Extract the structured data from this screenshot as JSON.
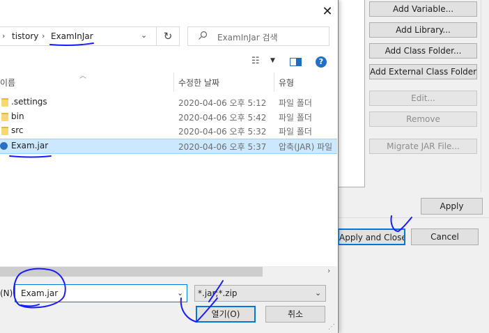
{
  "eclipse": {
    "buttons": {
      "add_variable": "Add Variable...",
      "add_library": "Add Library...",
      "add_class_folder": "Add Class Folder...",
      "add_external_class_folder": "Add External Class Folder...",
      "edit": "Edit...",
      "remove": "Remove",
      "migrate_jar": "Migrate JAR File..."
    },
    "apply": "Apply",
    "apply_and_close": "Apply and Close",
    "cancel": "Cancel"
  },
  "open_dialog": {
    "close": "✕",
    "breadcrumb": [
      "tistory",
      "ExamInJar"
    ],
    "breadcrumb_sep": "›",
    "search_placeholder": "ExamInJar 검색",
    "columns": {
      "name": "이름",
      "date": "수정한 날짜",
      "type": "유형"
    },
    "files": [
      {
        "name": ".settings",
        "date": "2020-04-06 오후 5:12",
        "type": "파일 폴더",
        "kind": "folder",
        "selected": false
      },
      {
        "name": "bin",
        "date": "2020-04-06 오후 5:42",
        "type": "파일 폴더",
        "kind": "folder",
        "selected": false
      },
      {
        "name": "src",
        "date": "2020-04-06 오후 5:32",
        "type": "파일 폴더",
        "kind": "folder",
        "selected": false
      },
      {
        "name": "Exam.jar",
        "date": "2020-04-06 오후 5:37",
        "type": "압축(JAR) 파일",
        "kind": "jar",
        "selected": true
      }
    ],
    "filename_label": "(N):",
    "filename_value": "Exam.jar",
    "filter_value": "*.jar;*.zip",
    "open_button": "열기(O)",
    "cancel_button": "취소"
  },
  "colors": {
    "selection": "#cce8ff",
    "accent": "#0078d7",
    "annotation_ink": "#1a1aff"
  }
}
